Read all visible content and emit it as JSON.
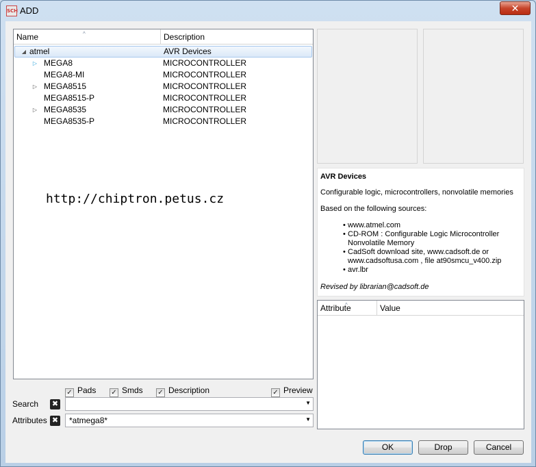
{
  "window": {
    "title": "ADD",
    "app_icon_text": "SCH",
    "close_label": "✕"
  },
  "tree": {
    "columns": {
      "name": "Name",
      "description": "Description"
    },
    "rows": [
      {
        "name": "atmel",
        "description": "AVR Devices",
        "expander": "◢",
        "selected": true
      },
      {
        "name": "MEGA8",
        "description": "MICROCONTROLLER",
        "expander": "▷"
      },
      {
        "name": "MEGA8-MI",
        "description": "MICROCONTROLLER",
        "expander": ""
      },
      {
        "name": "MEGA8515",
        "description": "MICROCONTROLLER",
        "expander": "▷"
      },
      {
        "name": "MEGA8515-P",
        "description": "MICROCONTROLLER",
        "expander": ""
      },
      {
        "name": "MEGA8535",
        "description": "MICROCONTROLLER",
        "expander": "▷"
      },
      {
        "name": "MEGA8535-P",
        "description": "MICROCONTROLLER",
        "expander": ""
      }
    ]
  },
  "watermark": "http://chiptron.petus.cz",
  "filters": {
    "pads": "Pads",
    "smds": "Smds",
    "description": "Description",
    "preview": "Preview",
    "check_mark": "✓"
  },
  "search": {
    "label": "Search",
    "value": ""
  },
  "attributes": {
    "label": "Attributes",
    "value": "*atmega8*"
  },
  "clear_glyph": "✖",
  "dropdown_glyph": "▼",
  "description_pane": {
    "heading": "AVR Devices",
    "line1": "Configurable logic, microcontrollers, nonvolatile memories",
    "line2": "Based on the following sources:",
    "sources": [
      "www.atmel.com",
      "CD-ROM : Configurable Logic Microcontroller",
      "Nonvolatile Memory",
      "CadSoft download site, www.cadsoft.de or",
      "www.cadsoftusa.com , file at90smcu_v400.zip",
      "avr.lbr"
    ],
    "revised": "Revised by librarian@cadsoft.de"
  },
  "attribute_table": {
    "columns": {
      "attribute": "Attribute",
      "value": "Value"
    }
  },
  "buttons": {
    "ok": "OK",
    "drop": "Drop",
    "cancel": "Cancel"
  },
  "colors": {
    "selection": "#dbe9f8",
    "accent": "#26a0da",
    "close": "#c7452b"
  }
}
